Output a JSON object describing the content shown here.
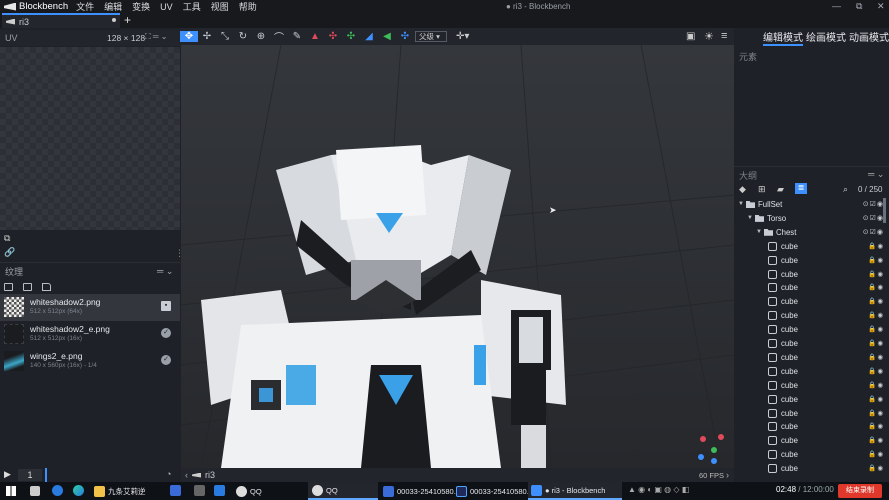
{
  "app": {
    "name": "Blockbench",
    "menu": [
      "文件",
      "编辑",
      "变换",
      "UV",
      "工具",
      "视图",
      "帮助"
    ],
    "window_title": "● ri3 - Blockbench",
    "window_controls": [
      "—",
      "⧉",
      "✕"
    ]
  },
  "tab": {
    "label": "ri3",
    "add": "+"
  },
  "uv": {
    "label": "UV",
    "size": "128 × 128"
  },
  "textures": {
    "header": "纹理",
    "items": [
      {
        "name": "whiteshadow2.png",
        "meta": "512 x 512px (64x)",
        "selected": true
      },
      {
        "name": "whiteshadow2_e.png",
        "meta": "512 x 512px (16x)",
        "selected": false
      },
      {
        "name": "wings2_e.png",
        "meta": "140 x 560px (16x) - 1/4",
        "selected": false
      }
    ]
  },
  "toolbar": {
    "pivot": "父级"
  },
  "modes": {
    "edit": "编辑模式",
    "paint": "绘画模式",
    "animate": "动画模式"
  },
  "elements": {
    "header": "元素"
  },
  "outliner": {
    "header": "大纲",
    "count": "0 / 250",
    "rows": [
      {
        "label": "FullSet",
        "level": 0,
        "kind": "group"
      },
      {
        "label": "Torso",
        "level": 1,
        "kind": "group"
      },
      {
        "label": "Chest",
        "level": 2,
        "kind": "group"
      },
      {
        "label": "cube",
        "kind": "cube"
      },
      {
        "label": "cube",
        "kind": "cube"
      },
      {
        "label": "cube",
        "kind": "cube"
      },
      {
        "label": "cube",
        "kind": "cube"
      },
      {
        "label": "cube",
        "kind": "cube"
      },
      {
        "label": "cube",
        "kind": "cube"
      },
      {
        "label": "cube",
        "kind": "cube"
      },
      {
        "label": "cube",
        "kind": "cube"
      },
      {
        "label": "cube",
        "kind": "cube"
      },
      {
        "label": "cube",
        "kind": "cube"
      },
      {
        "label": "cube",
        "kind": "cube"
      },
      {
        "label": "cube",
        "kind": "cube"
      },
      {
        "label": "cube",
        "kind": "cube"
      },
      {
        "label": "cube",
        "kind": "cube"
      },
      {
        "label": "cube",
        "kind": "cube"
      },
      {
        "label": "cube",
        "kind": "cube"
      },
      {
        "label": "cube",
        "kind": "cube"
      }
    ]
  },
  "viewport": {
    "tab": "ri3",
    "fps": "60 FPS"
  },
  "timeline": {
    "frame": "1"
  },
  "taskbar": {
    "items": [
      "九条艾莉逆",
      "QQ",
      "QQ",
      "00033-25410580...",
      "00033-25410580...",
      "● ri3 - Blockbench"
    ],
    "time": "02:48",
    "duration": "/ 12:00:00",
    "record": "结束录制"
  },
  "colors": {
    "accent": "#3e90ff",
    "record": "#e0392b",
    "panel": "#1e2127"
  }
}
